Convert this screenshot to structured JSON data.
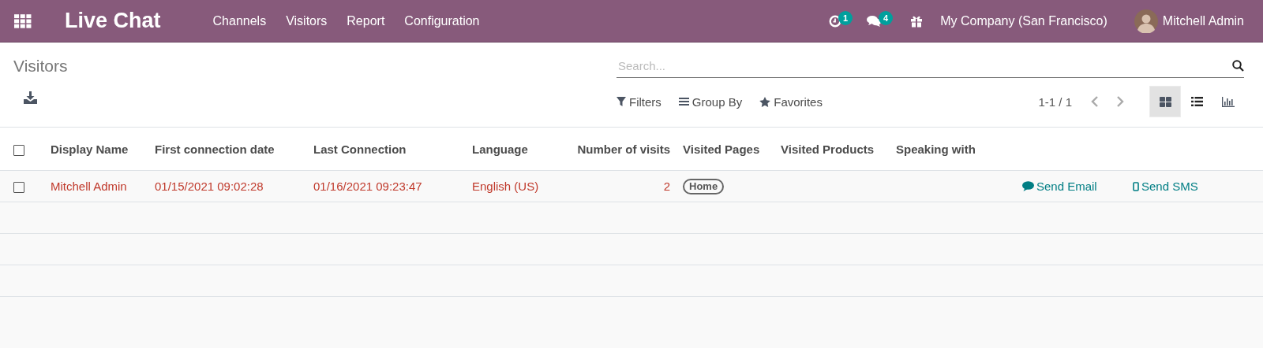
{
  "navbar": {
    "app_title": "Live Chat",
    "menu": [
      "Channels",
      "Visitors",
      "Report",
      "Configuration"
    ],
    "activity_count": "1",
    "message_count": "4",
    "company": "My Company (San Francisco)",
    "user": "Mitchell Admin"
  },
  "control_panel": {
    "breadcrumb": "Visitors",
    "search": {
      "placeholder": "Search..."
    },
    "filters": [
      {
        "kind": "filter",
        "label": "Filters"
      },
      {
        "kind": "group",
        "label": "Group By"
      },
      {
        "kind": "favorite",
        "label": "Favorites"
      }
    ],
    "pager": "1-1 / 1",
    "views": [
      {
        "kind": "kanban",
        "selected": true
      },
      {
        "kind": "list",
        "selected": false
      },
      {
        "kind": "graph",
        "selected": false
      }
    ]
  },
  "table": {
    "select_all_checked": false,
    "columns": [
      "Display Name",
      "First connection date",
      "Last Connection",
      "Language",
      "Number of visits",
      "Visited Pages",
      "Visited Products",
      "Speaking with"
    ],
    "rows": [
      {
        "checked": false,
        "display_name": "Mitchell Admin",
        "first_connection": "01/15/2021 09:02:28",
        "last_connection": "01/16/2021 09:23:47",
        "language": "English (US)",
        "visits": "2",
        "visited_pages": [
          "Home"
        ],
        "actions": [
          {
            "kind": "email",
            "label": "Send Email"
          },
          {
            "kind": "sms",
            "label": "Send SMS"
          }
        ]
      }
    ]
  }
}
